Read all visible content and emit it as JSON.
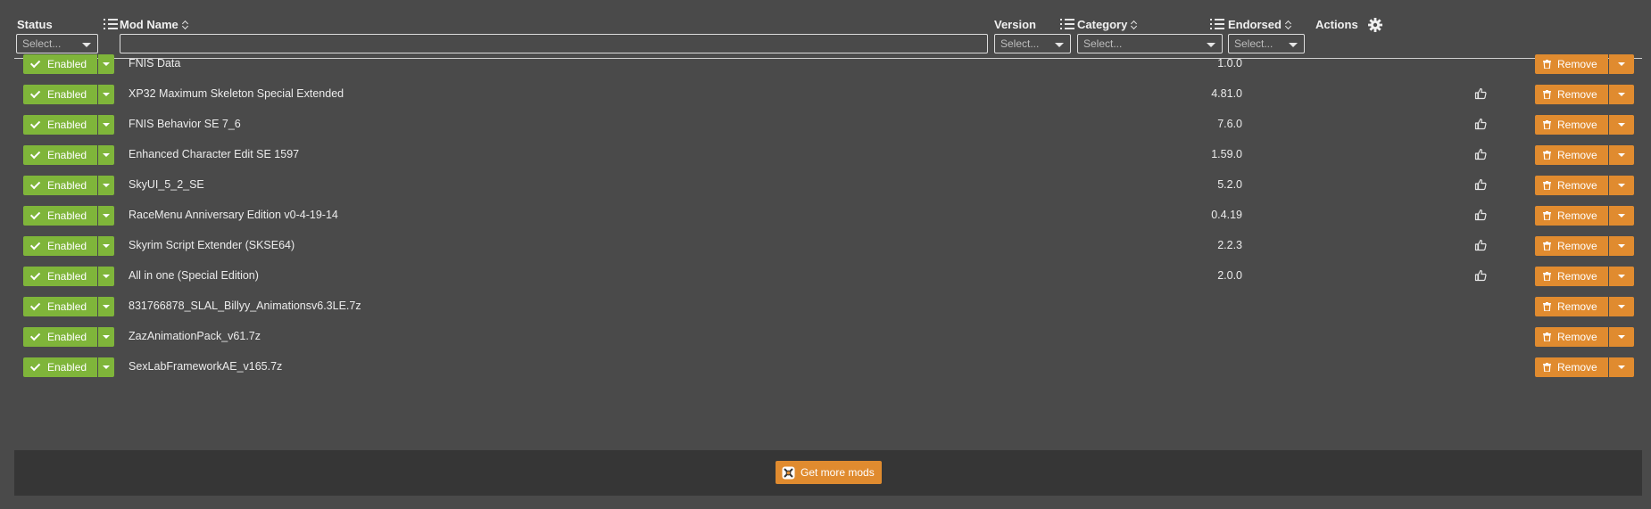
{
  "header": {
    "status_label": "Status",
    "mod_name_label": "Mod Name",
    "version_label": "Version",
    "category_label": "Category",
    "endorsed_label": "Endorsed",
    "actions_label": "Actions",
    "status_filter_placeholder": "Select...",
    "version_filter_placeholder": "Select...",
    "category_filter_placeholder": "Select...",
    "endorsed_filter_placeholder": "Select...",
    "mod_name_filter_value": ""
  },
  "rows": [
    {
      "status": "Enabled",
      "name": "FNIS Data",
      "version": "1.0.0",
      "endorse_icon": false,
      "action": "Remove"
    },
    {
      "status": "Enabled",
      "name": "XP32 Maximum Skeleton Special Extended",
      "version": "4.81.0",
      "endorse_icon": true,
      "action": "Remove"
    },
    {
      "status": "Enabled",
      "name": "FNIS Behavior SE 7_6",
      "version": "7.6.0",
      "endorse_icon": true,
      "action": "Remove"
    },
    {
      "status": "Enabled",
      "name": "Enhanced Character Edit SE 1597",
      "version": "1.59.0",
      "endorse_icon": true,
      "action": "Remove"
    },
    {
      "status": "Enabled",
      "name": "SkyUI_5_2_SE",
      "version": "5.2.0",
      "endorse_icon": true,
      "action": "Remove"
    },
    {
      "status": "Enabled",
      "name": "RaceMenu Anniversary Edition v0-4-19-14",
      "version": "0.4.19",
      "endorse_icon": true,
      "action": "Remove"
    },
    {
      "status": "Enabled",
      "name": "Skyrim Script Extender (SKSE64)",
      "version": "2.2.3",
      "endorse_icon": true,
      "action": "Remove"
    },
    {
      "status": "Enabled",
      "name": "All in one (Special Edition)",
      "version": "2.0.0",
      "endorse_icon": true,
      "action": "Remove"
    },
    {
      "status": "Enabled",
      "name": "831766878_SLAL_Billyy_Animationsv6.3LE.7z",
      "version": "",
      "endorse_icon": false,
      "action": "Remove"
    },
    {
      "status": "Enabled",
      "name": "ZazAnimationPack_v61.7z",
      "version": "",
      "endorse_icon": false,
      "action": "Remove"
    },
    {
      "status": "Enabled",
      "name": "SexLabFrameworkAE_v165.7z",
      "version": "",
      "endorse_icon": false,
      "action": "Remove"
    }
  ],
  "footer": {
    "get_more_label": "Get more mods"
  },
  "icons": {
    "settings": "gear-icon",
    "column_toggle": "list-icon",
    "sort": "sort-icon",
    "status_enabled": "check-icon",
    "endorsed": "thumbs-up-icon",
    "remove": "trash-icon",
    "get_more": "nexus-icon"
  },
  "colors": {
    "background": "#4a4a4a",
    "enabled_green": "#7fb53a",
    "remove_orange": "#e08b2f",
    "footer_bg": "#363636"
  }
}
